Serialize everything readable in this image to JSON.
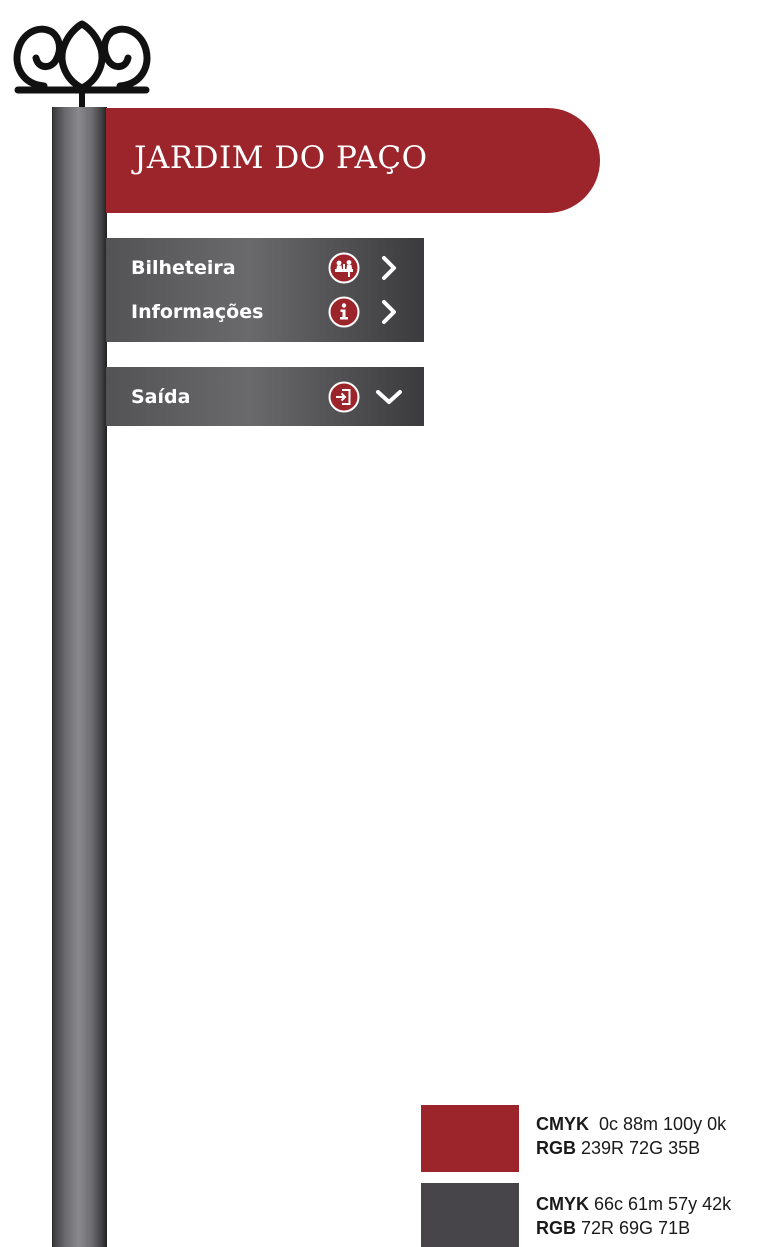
{
  "sign": {
    "title": "JARDIM DO PAÇO",
    "directions": [
      {
        "label": "Bilheteira",
        "icon": "ticket-office-icon",
        "arrow": "chevron-right-icon"
      },
      {
        "label": "Informações",
        "icon": "info-icon",
        "arrow": "chevron-right-icon"
      },
      {
        "label": "Saída",
        "icon": "exit-icon",
        "arrow": "chevron-down-icon"
      }
    ]
  },
  "swatches": [
    {
      "color": "#9c242b",
      "cmyk_key": "CMYK",
      "cmyk_value": "0c 88m 100y 0k",
      "rgb_key": "RGB",
      "rgb_value": "239R 72G 35B"
    },
    {
      "color": "#48454a",
      "cmyk_key": "CMYK",
      "cmyk_value": "66c 61m 57y 42k",
      "rgb_key": "RGB",
      "rgb_value": "72R 69G 71B"
    }
  ],
  "colors": {
    "accent_red": "#9c242b",
    "panel_grey": "#48454a",
    "pole_grey": "#8a8a8e"
  }
}
